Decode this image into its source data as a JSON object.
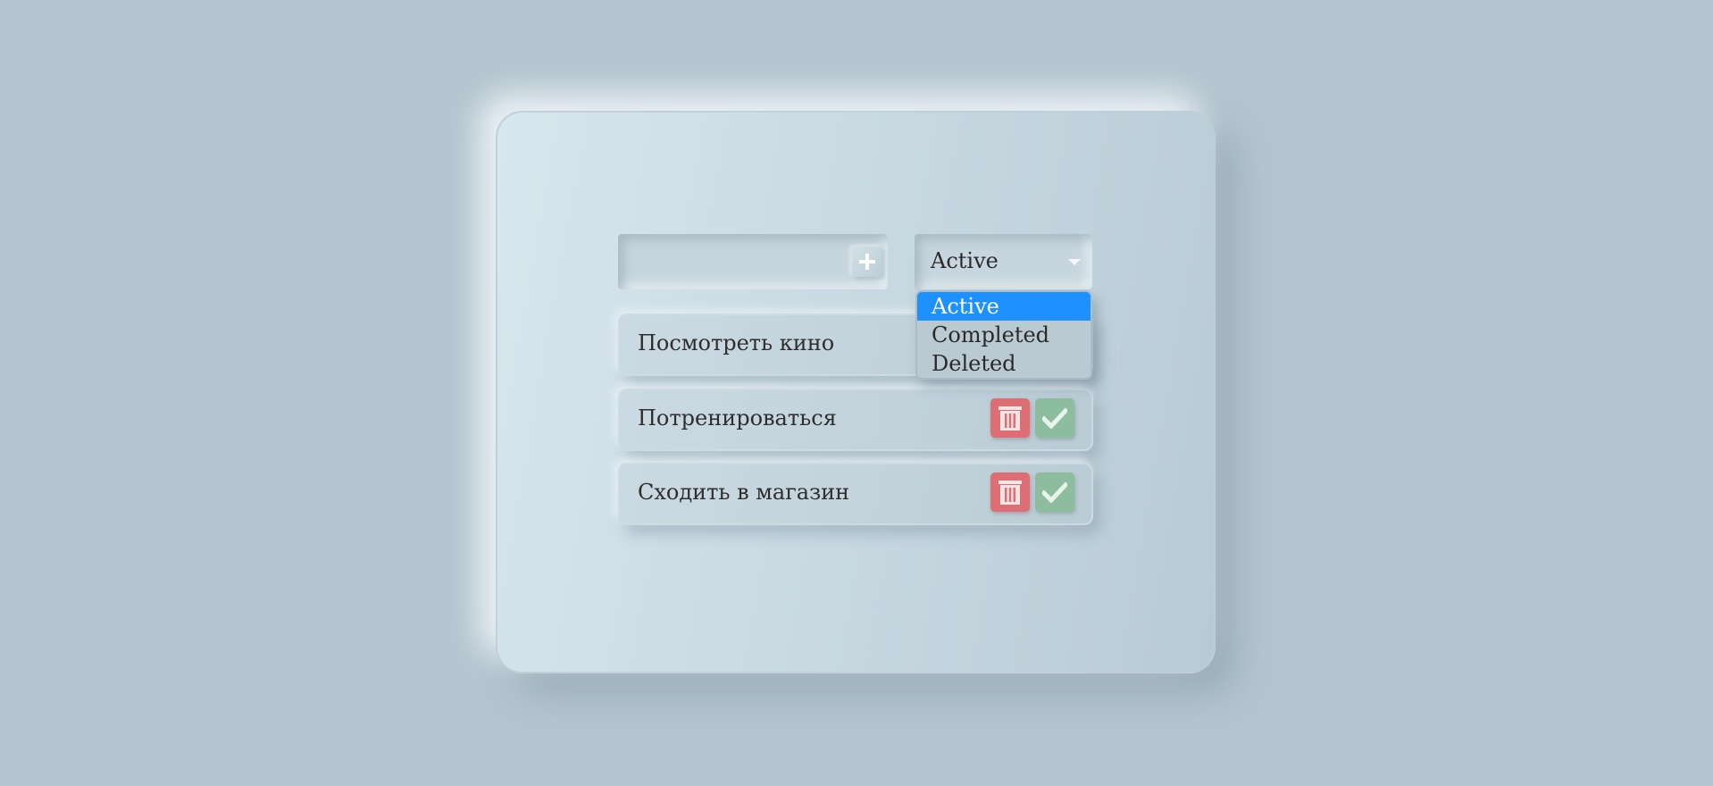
{
  "add_form": {
    "input_value": "",
    "add_icon": "plus-icon"
  },
  "filter": {
    "selected": "Active",
    "options": [
      "Active",
      "Completed",
      "Deleted"
    ],
    "highlight_color": "#1e90ff"
  },
  "tasks": [
    {
      "label": "Посмотреть кино"
    },
    {
      "label": "Потренироваться"
    },
    {
      "label": "Сходить в магазин"
    }
  ],
  "colors": {
    "background": "#b4c5cf",
    "delete_button": "#dd6f74",
    "complete_button": "#8cbd9e"
  },
  "icons": {
    "delete": "trash-icon",
    "complete": "check-icon",
    "dropdown": "caret-down-icon"
  }
}
